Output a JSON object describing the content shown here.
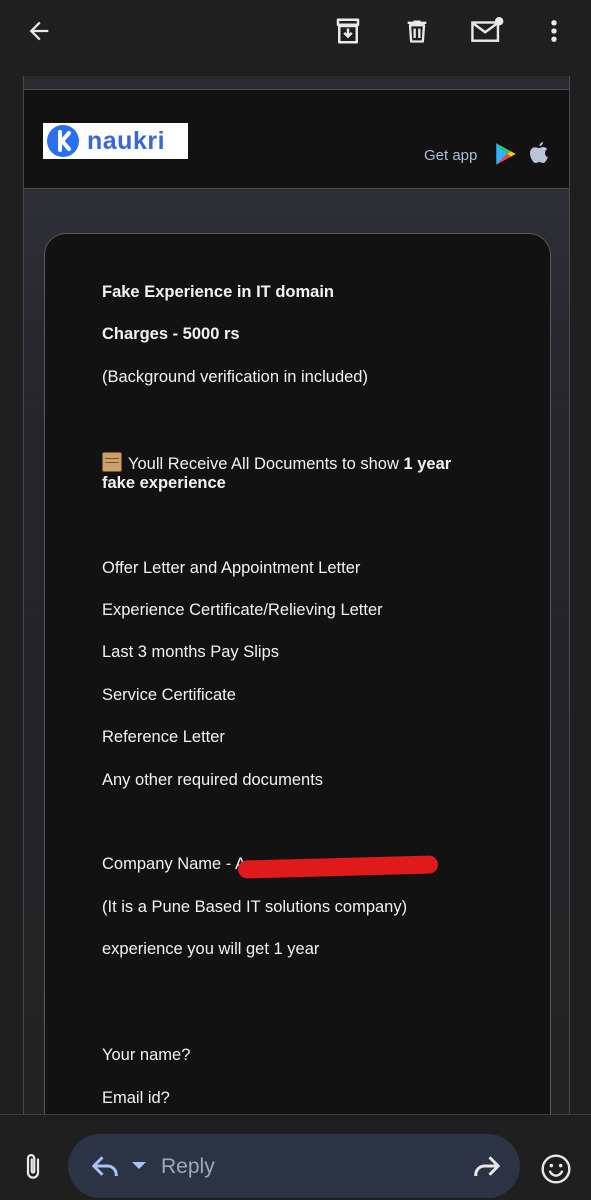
{
  "toolbar": {
    "icons": [
      "back-arrow-icon",
      "archive-icon",
      "trash-icon",
      "mark-unread-icon",
      "more-vert-icon"
    ]
  },
  "email": {
    "brand_name": "naukri",
    "get_app_label": "Get app",
    "store_icons": [
      "google-play-icon",
      "apple-icon"
    ],
    "lines": {
      "l1": "Fake Experience in IT domain",
      "l2": "Charges - 5000 rs",
      "l3": "(Background verification in included)",
      "l4_text": "Youll Receive All Documents to show ",
      "l4_bold": "1 year",
      "l5": "fake experience",
      "docs": [
        "Offer Letter and Appointment Letter",
        "Experience Certificate/Relieving Letter",
        "Last 3 months Pay Slips",
        "Service Certificate",
        "Reference Letter",
        "Any other required documents"
      ],
      "company_prefix": "Company Name - A",
      "company_note": "(It is a Pune Based IT solutions company)",
      "experience_line": "experience you will get 1 year",
      "your_name": "Your name?",
      "email_id": "Email id?"
    }
  },
  "bottom_bar": {
    "reply_placeholder": "Reply",
    "icons": [
      "attachment-icon",
      "reply-icon",
      "chevron-down-icon",
      "forward-icon",
      "emoji-icon"
    ]
  },
  "colors": {
    "accent": "#a9c1f5",
    "redaction": "#e01a1a",
    "brand_blue": "#3a66d8"
  }
}
